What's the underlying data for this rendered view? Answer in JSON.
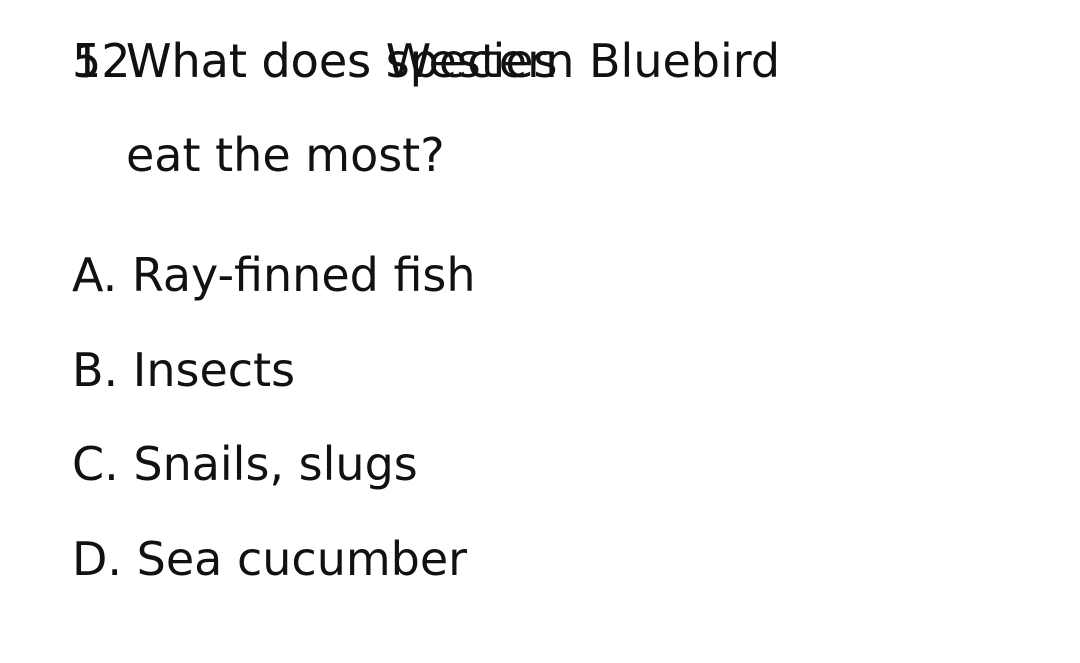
{
  "question": {
    "line1_text": "What does Western Bluebird",
    "overlay_text": "What does species",
    "number_label": "12.",
    "overlay_number_label": "5.",
    "line2_text": "eat the most?"
  },
  "options": [
    {
      "label": "A. Ray-finned fish"
    },
    {
      "label": "B. Insects"
    },
    {
      "label": "C. Snails, slugs"
    },
    {
      "label": "D. Sea cucumber"
    }
  ]
}
